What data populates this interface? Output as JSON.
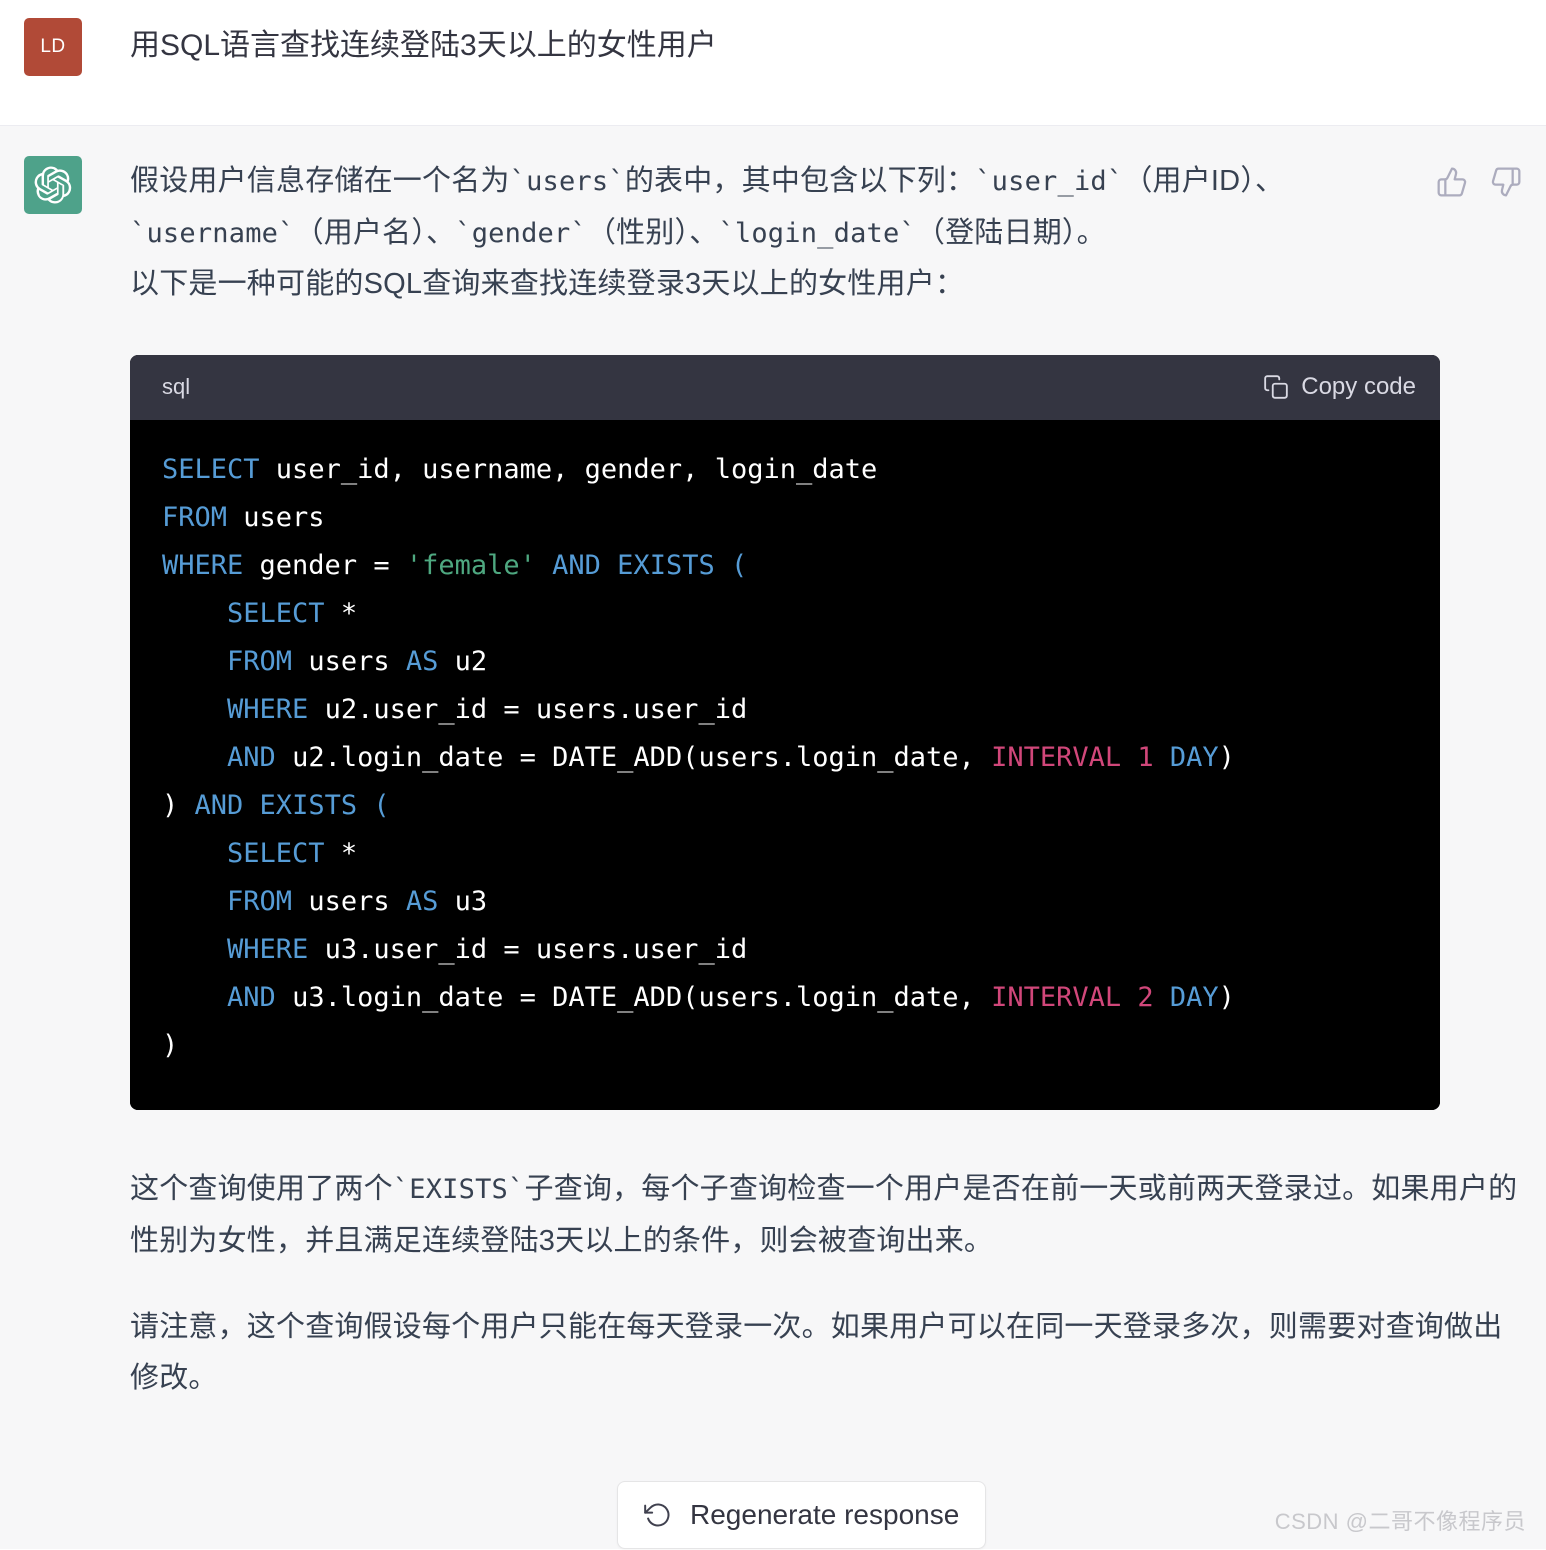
{
  "theme": {
    "user_bg": "#ffffff",
    "assistant_bg": "#f7f7f8",
    "user_avatar_bg": "#b14a37",
    "assistant_avatar_bg": "#4ea28a",
    "code_header_bg": "#343541",
    "code_body_bg": "#000000",
    "text_color": "#374151",
    "keyword_color": "#569cd6",
    "string_color": "#4ea880",
    "number_color": "#d1477a"
  },
  "user": {
    "avatar_initials": "LD",
    "avatar_icon": "user-avatar",
    "message": "用SQL语言查找连续登陆3天以上的女性用户"
  },
  "assistant": {
    "avatar_icon": "openai-logo-icon",
    "paragraph_1": "假设用户信息存储在一个名为`users`的表中，其中包含以下列：`user_id`（用户ID）、`username`（用户名）、`gender`（性别）、`login_date`（登陆日期）。",
    "paragraph_2": "以下是一种可能的SQL查询来查找连续登录3天以上的女性用户：",
    "paragraph_3": "这个查询使用了两个`EXISTS`子查询，每个子查询检查一个用户是否在前一天或前两天登录过。如果用户的性别为女性，并且满足连续登陆3天以上的条件，则会被查询出来。",
    "paragraph_4": "请注意，这个查询假设每个用户只能在每天登录一次。如果用户可以在同一天登录多次，则需要对查询做出修改。",
    "feedback": {
      "thumbs_up_icon": "thumbs-up-icon",
      "thumbs_down_icon": "thumbs-down-icon"
    }
  },
  "code_block": {
    "language": "sql",
    "copy_label": "Copy code",
    "copy_icon": "clipboard-icon",
    "lines": [
      [
        {
          "t": "SELECT",
          "c": "kw"
        },
        {
          "t": " user_id, username, gender, login_date",
          "c": "pln"
        }
      ],
      [
        {
          "t": "FROM",
          "c": "kw"
        },
        {
          "t": " users",
          "c": "pln"
        }
      ],
      [
        {
          "t": "WHERE",
          "c": "kw"
        },
        {
          "t": " gender = ",
          "c": "pln"
        },
        {
          "t": "'female'",
          "c": "str"
        },
        {
          "t": " ",
          "c": "pln"
        },
        {
          "t": "AND EXISTS",
          "c": "kw"
        },
        {
          "t": " ",
          "c": "pln"
        },
        {
          "t": "(",
          "c": "kw"
        }
      ],
      [
        {
          "t": "    ",
          "c": "pln"
        },
        {
          "t": "SELECT",
          "c": "kw"
        },
        {
          "t": " *",
          "c": "pln"
        }
      ],
      [
        {
          "t": "    ",
          "c": "pln"
        },
        {
          "t": "FROM",
          "c": "kw"
        },
        {
          "t": " users ",
          "c": "pln"
        },
        {
          "t": "AS",
          "c": "kw"
        },
        {
          "t": " u2",
          "c": "pln"
        }
      ],
      [
        {
          "t": "    ",
          "c": "pln"
        },
        {
          "t": "WHERE",
          "c": "kw"
        },
        {
          "t": " u2.user_id = users.user_id",
          "c": "pln"
        }
      ],
      [
        {
          "t": "    ",
          "c": "pln"
        },
        {
          "t": "AND",
          "c": "kw"
        },
        {
          "t": " u2.login_date = DATE_ADD(users.login_date, ",
          "c": "pln"
        },
        {
          "t": "INTERVAL 1",
          "c": "num"
        },
        {
          "t": " ",
          "c": "pln"
        },
        {
          "t": "DAY",
          "c": "kw"
        },
        {
          "t": ")",
          "c": "pln"
        }
      ],
      [
        {
          "t": ")",
          "c": "pln"
        },
        {
          "t": " ",
          "c": "pln"
        },
        {
          "t": "AND EXISTS",
          "c": "kw"
        },
        {
          "t": " ",
          "c": "pln"
        },
        {
          "t": "(",
          "c": "kw"
        }
      ],
      [
        {
          "t": "    ",
          "c": "pln"
        },
        {
          "t": "SELECT",
          "c": "kw"
        },
        {
          "t": " *",
          "c": "pln"
        }
      ],
      [
        {
          "t": "    ",
          "c": "pln"
        },
        {
          "t": "FROM",
          "c": "kw"
        },
        {
          "t": " users ",
          "c": "pln"
        },
        {
          "t": "AS",
          "c": "kw"
        },
        {
          "t": " u3",
          "c": "pln"
        }
      ],
      [
        {
          "t": "    ",
          "c": "pln"
        },
        {
          "t": "WHERE",
          "c": "kw"
        },
        {
          "t": " u3.user_id = users.user_id",
          "c": "pln"
        }
      ],
      [
        {
          "t": "    ",
          "c": "pln"
        },
        {
          "t": "AND",
          "c": "kw"
        },
        {
          "t": " u3.login_date = DATE_ADD(users.login_date, ",
          "c": "pln"
        },
        {
          "t": "INTERVAL 2",
          "c": "num"
        },
        {
          "t": " ",
          "c": "pln"
        },
        {
          "t": "DAY",
          "c": "kw"
        },
        {
          "t": ")",
          "c": "pln"
        }
      ],
      [
        {
          "t": ")",
          "c": "pln"
        }
      ]
    ]
  },
  "regenerate": {
    "label": "Regenerate response",
    "icon": "refresh-icon"
  },
  "watermark": {
    "text": "CSDN @二哥不像程序员"
  }
}
